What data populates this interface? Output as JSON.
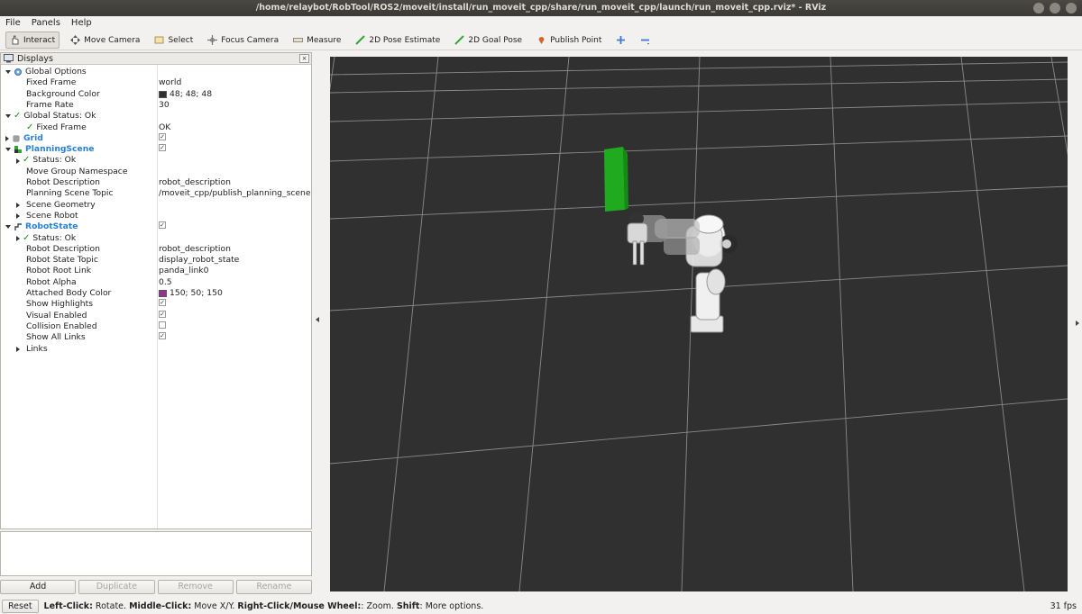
{
  "window": {
    "title": "/home/relaybot/RobTool/ROS2/moveit/install/run_moveit_cpp/share/run_moveit_cpp/launch/run_moveit_cpp.rviz* - RViz"
  },
  "menu": [
    "File",
    "Panels",
    "Help"
  ],
  "toolbar": {
    "interact": "Interact",
    "move_camera": "Move Camera",
    "select": "Select",
    "focus_camera": "Focus Camera",
    "measure": "Measure",
    "pose_estimate": "2D Pose Estimate",
    "goal_pose": "2D Goal Pose",
    "publish_point": "Publish Point"
  },
  "displays": {
    "title": "Displays",
    "close": "×",
    "rows": [
      {
        "name": "Global Options",
        "value": ""
      },
      {
        "name": "Fixed Frame",
        "value": "world"
      },
      {
        "name": "Background Color",
        "value": "48; 48; 48",
        "color": "#303030"
      },
      {
        "name": "Frame Rate",
        "value": "30"
      },
      {
        "name": "Global Status: Ok",
        "value": ""
      },
      {
        "name": "Fixed Frame",
        "value": "OK"
      },
      {
        "name": "Grid",
        "value": ""
      },
      {
        "name": "PlanningScene",
        "value": ""
      },
      {
        "name": "Status: Ok",
        "value": ""
      },
      {
        "name": "Move Group Namespace",
        "value": ""
      },
      {
        "name": "Robot Description",
        "value": "robot_description"
      },
      {
        "name": "Planning Scene Topic",
        "value": "/moveit_cpp/publish_planning_scene"
      },
      {
        "name": "Scene Geometry",
        "value": ""
      },
      {
        "name": "Scene Robot",
        "value": ""
      },
      {
        "name": "RobotState",
        "value": ""
      },
      {
        "name": "Status: Ok",
        "value": ""
      },
      {
        "name": "Robot Description",
        "value": "robot_description"
      },
      {
        "name": "Robot State Topic",
        "value": "display_robot_state"
      },
      {
        "name": "Robot Root Link",
        "value": "panda_link0"
      },
      {
        "name": "Robot Alpha",
        "value": "0.5"
      },
      {
        "name": "Attached Body Color",
        "value": "150; 50; 150",
        "color": "#963296"
      },
      {
        "name": "Show Highlights",
        "value": ""
      },
      {
        "name": "Visual Enabled",
        "value": ""
      },
      {
        "name": "Collision Enabled",
        "value": ""
      },
      {
        "name": "Show All Links",
        "value": ""
      },
      {
        "name": "Links",
        "value": ""
      }
    ]
  },
  "buttons": {
    "add": "Add",
    "duplicate": "Duplicate",
    "remove": "Remove",
    "rename": "Rename"
  },
  "status": {
    "reset": "Reset",
    "left_click": "Left-Click:",
    "rotate": " Rotate. ",
    "middle_click": "Middle-Click:",
    "move": " Move X/Y. ",
    "right_click": "Right-Click/Mouse Wheel:",
    "zoom": ": Zoom. ",
    "shift": "Shift",
    "more": ": More options.",
    "fps": "31 fps"
  },
  "colors": {
    "viewport_bg": "#303030",
    "collision_box": "#1faa1f",
    "accent_blue": "#2a7fd6"
  }
}
